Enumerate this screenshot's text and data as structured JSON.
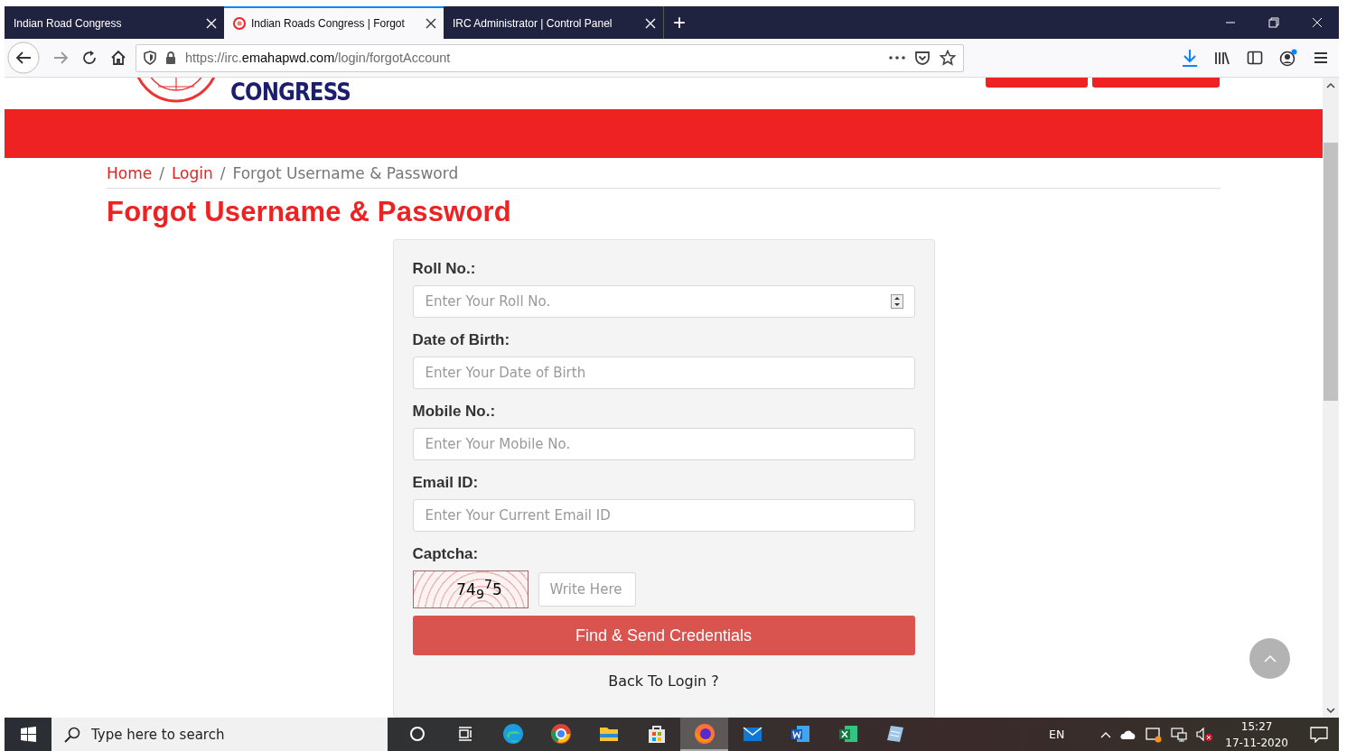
{
  "browser": {
    "tabs": [
      {
        "title": "Indian Road Congress",
        "selected": false,
        "favicon": false
      },
      {
        "title": "Indian Roads Congress | Forgot",
        "selected": true,
        "favicon": true
      },
      {
        "title": "IRC Administrator | Control Panel",
        "selected": false,
        "favicon": false
      }
    ],
    "new_tab": "+",
    "url": {
      "scheme": "https://irc.",
      "domain": "emahapwd.com",
      "path": "/login/forgotAccount"
    }
  },
  "header": {
    "logo_text": "CONGRESS"
  },
  "breadcrumb": [
    {
      "label": "Home",
      "kind": "link"
    },
    {
      "label": "Login",
      "kind": "link",
      "separator": "/"
    },
    {
      "label": "Forgot Username & Password",
      "kind": "current",
      "separator": "/"
    }
  ],
  "page_title": "Forgot Username & Password",
  "form": {
    "fields": [
      {
        "label": "Roll No.:",
        "placeholder": "Enter Your Roll No.",
        "kind": "number"
      },
      {
        "label": "Date of Birth:",
        "placeholder": "Enter Your Date of Birth",
        "kind": "text"
      },
      {
        "label": "Mobile No.:",
        "placeholder": "Enter Your Mobile No.",
        "kind": "text"
      },
      {
        "label": "Email ID:",
        "placeholder": "Enter Your Current Email ID",
        "kind": "text"
      }
    ],
    "captcha": {
      "label": "Captcha:",
      "code": "74$_{9}$$^{7}$5",
      "placeholder": "Write Here"
    },
    "submit": "Find & Send Credentials",
    "back_link": "Back To Login ?"
  },
  "taskbar": {
    "search_placeholder": "Type here to search",
    "apps": [
      {
        "kind": "cortana",
        "selected": false
      },
      {
        "kind": "taskview",
        "selected": false
      },
      {
        "kind": "edge",
        "selected": false
      },
      {
        "kind": "chrome",
        "selected": false
      },
      {
        "kind": "explorer",
        "selected": false
      },
      {
        "kind": "store",
        "selected": false
      },
      {
        "kind": "firefox",
        "selected": true
      },
      {
        "kind": "mail",
        "selected": false
      },
      {
        "kind": "word",
        "selected": false
      },
      {
        "kind": "excel",
        "selected": false
      },
      {
        "kind": "notes",
        "selected": false
      }
    ],
    "language": "EN",
    "time": "15:27",
    "date": "17-11-2020"
  }
}
